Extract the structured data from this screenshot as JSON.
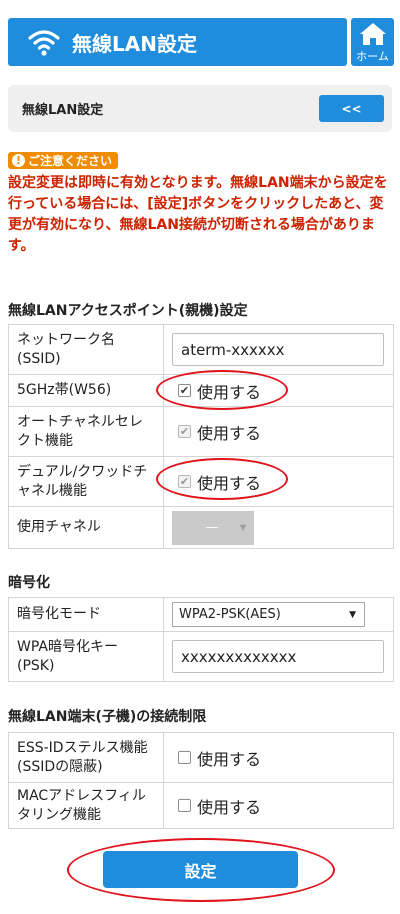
{
  "header": {
    "title": "無線LAN設定",
    "home_label": "ホーム"
  },
  "subbar": {
    "label": "無線LAN設定",
    "back_label": "<<"
  },
  "notice": {
    "badge": "ご注意ください",
    "text": "設定変更は即時に有効となります。無線LAN端末から設定を行っている場合には、[設定]ボタンをクリックしたあと、変更が有効になり、無線LAN接続が切断される場合があります。"
  },
  "access_point": {
    "title": "無線LANアクセスポイント(親機)設定",
    "ssid_label": "ネットワーク名(SSID)",
    "ssid_value": "aterm-xxxxxx",
    "w56_label": "5GHz帯(W56)",
    "w56_checked": true,
    "w56_text": "使用する",
    "auto_channel_label": "オートチャネルセレクト機能",
    "auto_channel_checked": true,
    "auto_channel_text": "使用する",
    "dual_quad_label": "デュアル/クワッドチャネル機能",
    "dual_quad_checked": true,
    "dual_quad_text": "使用する",
    "channel_label": "使用チャネル",
    "channel_value": "—"
  },
  "encryption": {
    "title": "暗号化",
    "mode_label": "暗号化モード",
    "mode_value": "WPA2-PSK(AES)",
    "key_label": "WPA暗号化キー(PSK)",
    "key_value": "xxxxxxxxxxxxx"
  },
  "connection_limit": {
    "title": "無線LAN端末(子機)の接続制限",
    "stealth_label": "ESS-IDステルス機能(SSIDの隠蔽)",
    "stealth_checked": false,
    "stealth_text": "使用する",
    "mac_filter_label": "MACアドレスフィルタリング機能",
    "mac_filter_checked": false,
    "mac_filter_text": "使用する"
  },
  "submit_label": "設定",
  "colors": {
    "primary": "#1f8ddc",
    "warning": "#f08c00",
    "notice_text": "#cc2200",
    "highlight_ring": "#e0141c"
  },
  "icons": {
    "header": "wifi-icon",
    "home": "home-icon",
    "notice": "exclamation-icon"
  }
}
